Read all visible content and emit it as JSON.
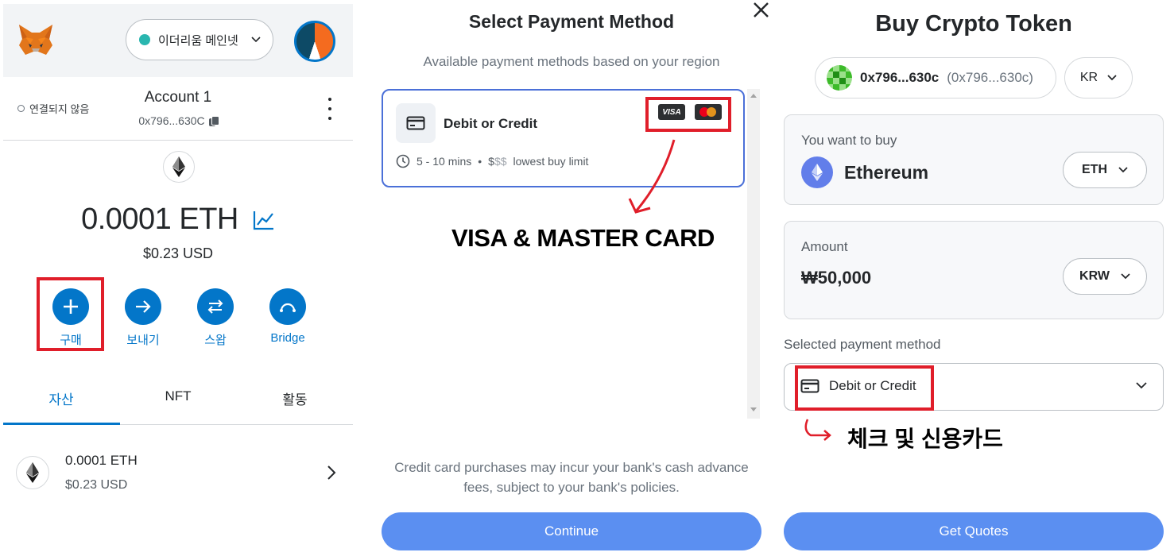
{
  "wallet": {
    "network": "이더리움 메인넷",
    "connection_status": "연결되지 않음",
    "account_name": "Account 1",
    "account_address": "0x796...630C",
    "balance": "0.0001 ETH",
    "balance_fiat": "$0.23 USD",
    "actions": [
      {
        "label": "구매",
        "icon": "plus-icon"
      },
      {
        "label": "보내기",
        "icon": "arrow-right-icon"
      },
      {
        "label": "스왑",
        "icon": "swap-icon"
      },
      {
        "label": "Bridge",
        "icon": "bridge-icon"
      }
    ],
    "tabs": [
      {
        "label": "자산",
        "active": true
      },
      {
        "label": "NFT",
        "active": false
      },
      {
        "label": "활동",
        "active": false
      }
    ],
    "assets": [
      {
        "amount": "0.0001 ETH",
        "fiat": "$0.23 USD"
      }
    ],
    "colors": {
      "primary": "#0376c9",
      "highlight": "#e01e2a",
      "network_dot": "#29b6af"
    }
  },
  "payment": {
    "title": "Select Payment Method",
    "subtitle": "Available payment methods based on your region",
    "option": {
      "name": "Debit or Credit",
      "time": "5 - 10 mins",
      "cost_active": "$",
      "cost_inactive": "$$",
      "limit": "lowest buy limit",
      "logos": [
        "VISA"
      ]
    },
    "annotation": "VISA & MASTER CARD",
    "note": "Credit card purchases may incur your bank's cash advance fees, subject to your bank's policies.",
    "continue_label": "Continue"
  },
  "buy": {
    "title": "Buy Crypto Token",
    "address_short": "0x796...630c",
    "address_paren": "(0x796...630c)",
    "region": "KR",
    "want_label": "You want to buy",
    "token_name": "Ethereum",
    "token_symbol": "ETH",
    "amount_label": "Amount",
    "amount_value": "₩50,000",
    "currency": "KRW",
    "selected_pm_label": "Selected payment method",
    "selected_pm": "Debit or Credit",
    "annotation": "체크 및 신용카드",
    "quotes_label": "Get Quotes",
    "colors": {
      "button": "#5b8ff1",
      "eth": "#627eea"
    }
  }
}
